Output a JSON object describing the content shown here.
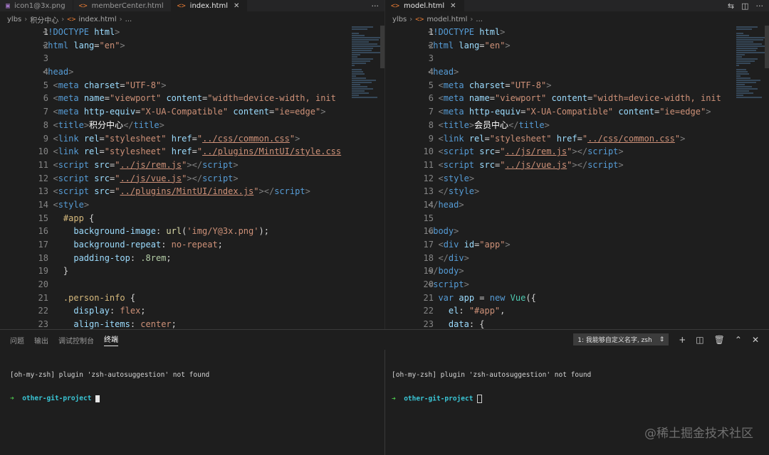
{
  "left_editor": {
    "tabs": [
      {
        "label": "icon1@3x.png",
        "active": false
      },
      {
        "label": "memberCenter.html",
        "active": false
      },
      {
        "label": "index.html",
        "active": true
      }
    ],
    "breadcrumb": [
      "ylbs",
      "积分中心",
      "index.html",
      "..."
    ]
  },
  "right_editor": {
    "tabs": [
      {
        "label": "model.html",
        "active": true
      }
    ],
    "breadcrumb": [
      "ylbs",
      "model.html",
      "..."
    ]
  },
  "panel": {
    "tabs": [
      "问题",
      "输出",
      "调试控制台",
      "终端"
    ],
    "active_tab": "终端",
    "terminal_select": "1: 我能够自定义名字, zsh",
    "terminal_left": {
      "line1": "[oh-my-zsh] plugin 'zsh-autosuggestion' not found",
      "prompt": "other-git-project"
    },
    "terminal_right": {
      "line1": "[oh-my-zsh] plugin 'zsh-autosuggestion' not found",
      "prompt": "other-git-project"
    }
  },
  "watermark": "@稀土掘金技术社区",
  "icons": [
    "ellipsis-icon",
    "split-editor-icon",
    "compare-icon",
    "layout-icon",
    "plus-icon",
    "trash-icon",
    "chevron-up-icon",
    "close-icon",
    "terminal-arrow-icon"
  ],
  "colors": {
    "background": "#1e1e1e",
    "tag": "#569cd6",
    "attribute": "#9cdcfe",
    "string": "#ce9178",
    "selector": "#d7ba7d",
    "prompt_arrow": "#4ec94e",
    "prompt_project": "#3ac6d6"
  }
}
